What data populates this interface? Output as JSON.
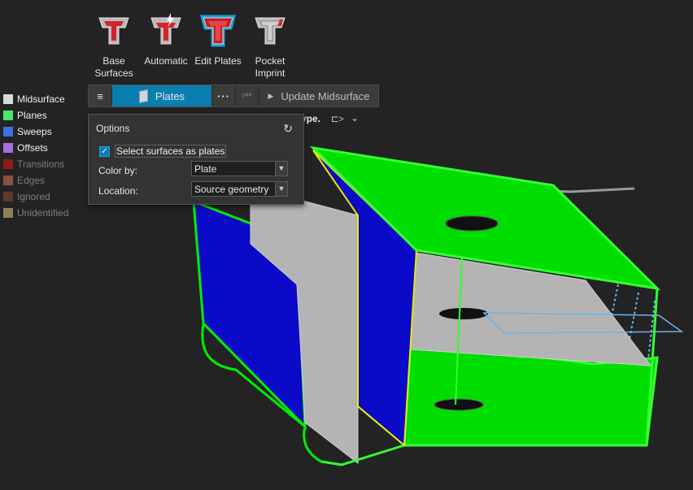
{
  "ribbon": [
    {
      "label": "Base\nSurfaces",
      "icon": "base-surfaces-icon"
    },
    {
      "label": "Automatic",
      "icon": "automatic-icon"
    },
    {
      "label": "Edit Plates",
      "icon": "edit-plates-icon",
      "active": true
    },
    {
      "label": "Pocket\nImprint",
      "icon": "pocket-imprint-icon"
    }
  ],
  "toolbar": {
    "menu_icon": "≡",
    "mode_label": "Plates",
    "more_icon": "···",
    "first_icon": "⏮",
    "update_label": "Update Midsurface",
    "update_icon": "▶"
  },
  "legend": [
    {
      "label": "Midsurface",
      "color": "#d9d9d9",
      "text_color": "#f0f0f0"
    },
    {
      "label": "Planes",
      "color": "#47e86a",
      "text_color": "#f0f0f0"
    },
    {
      "label": "Sweeps",
      "color": "#3f6fe0",
      "text_color": "#f0f0f0"
    },
    {
      "label": "Offsets",
      "color": "#a86fe0",
      "text_color": "#f0f0f0"
    },
    {
      "label": "Transitions",
      "color": "#8c1c1c",
      "text_color": "#7f7f7f"
    },
    {
      "label": "Edges",
      "color": "#8a5043",
      "text_color": "#7f7f7f"
    },
    {
      "label": "Ignored",
      "color": "#5c3a2e",
      "text_color": "#7f7f7f"
    },
    {
      "label": "Unidentified",
      "color": "#8e8157",
      "text_color": "#7f7f7f"
    }
  ],
  "options": {
    "title": "Options",
    "reset_icon": "↻",
    "checkbox_label": "Select surfaces as plates",
    "checkbox_checked": true,
    "color_by_label": "Color by:",
    "color_by_value": "Plate",
    "location_label": "Location:",
    "location_value": "Source geometry"
  },
  "partial_text": "ype.",
  "colors": {
    "accent": "#0a7eb0",
    "plane_green": "#00dd00",
    "sweep_blue": "#0a0ac8",
    "midsurface_grey": "#b8b8b8"
  }
}
